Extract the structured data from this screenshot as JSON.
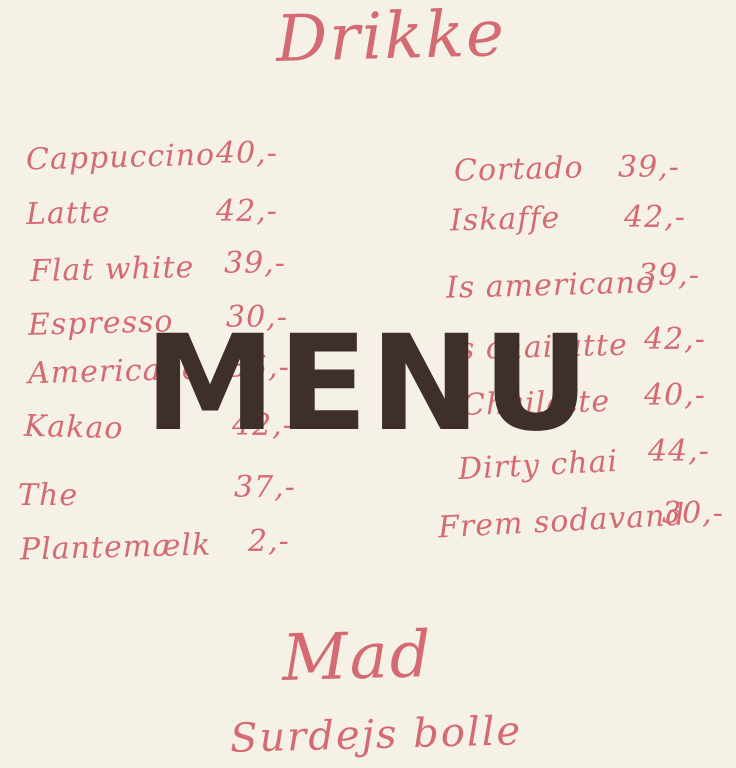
{
  "sections": {
    "drinks_heading": "Drikke",
    "food_heading": "Mad",
    "food_first_item": "Surdejs bolle"
  },
  "drinks_left": [
    {
      "name": "Cappuccino",
      "price": "40,-"
    },
    {
      "name": "Latte",
      "price": "42,-"
    },
    {
      "name": "Flat white",
      "price": "39,-"
    },
    {
      "name": "Espresso",
      "price": "30,-"
    },
    {
      "name": "Americano",
      "price": "35,-"
    },
    {
      "name": "Kakao",
      "price": "42,-"
    },
    {
      "name": "The",
      "price": "37,-"
    },
    {
      "name": "Plantemælk",
      "price": "2,-"
    }
  ],
  "drinks_right": [
    {
      "name": "Cortado",
      "price": "39,-"
    },
    {
      "name": "Iskaffe",
      "price": "42,-"
    },
    {
      "name": "Is americano",
      "price": "39,-"
    },
    {
      "name": "Is chailatte",
      "price": "42,-"
    },
    {
      "name": "Chailatte",
      "price": "40,-"
    },
    {
      "name": "Dirty chai",
      "price": "44,-"
    },
    {
      "name": "Frem sodavand",
      "price": "30,-"
    }
  ],
  "overlay": {
    "title": "MENU"
  },
  "colors": {
    "background": "#f5f1e6",
    "handwriting": "#d46a72",
    "overlay_text": "#3f2f2a"
  }
}
